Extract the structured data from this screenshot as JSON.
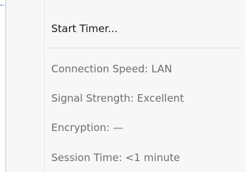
{
  "menu": {
    "action_item": {
      "label": "Start Timer..."
    },
    "status_items": [
      {
        "label": "Connection Speed: LAN"
      },
      {
        "label": "Signal Strength: Excellent"
      },
      {
        "label": "Encryption: —"
      },
      {
        "label": "Session Time: <1 minute"
      }
    ]
  },
  "colors": {
    "menu_background": "#f7f7f7",
    "enabled_text": "#1a1a1a",
    "disabled_text": "#6d6d6d",
    "tray_icon_blue": "#2f6fb5"
  },
  "icons": {
    "tray_icon": "network-tray-icon"
  }
}
